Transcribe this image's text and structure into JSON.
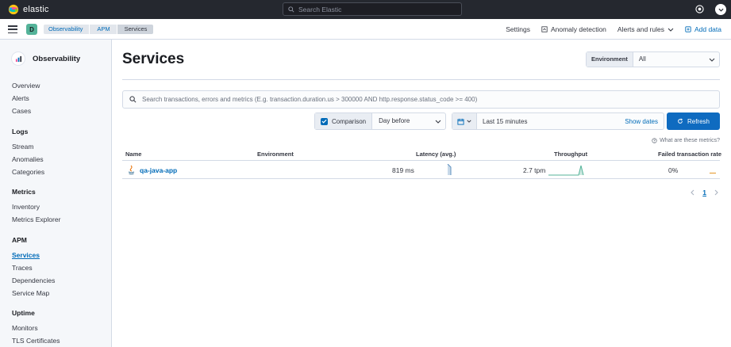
{
  "header": {
    "brand": "elastic",
    "search_placeholder": "Search Elastic"
  },
  "subheader": {
    "space_initial": "D",
    "breadcrumbs": [
      "Observability",
      "APM",
      "Services"
    ],
    "links": {
      "settings": "Settings",
      "anomaly": "Anomaly detection",
      "alerts": "Alerts and rules",
      "add_data": "Add data"
    }
  },
  "sidebar": {
    "title": "Observability",
    "groups": [
      {
        "heading": "",
        "items": [
          "Overview",
          "Alerts",
          "Cases"
        ]
      },
      {
        "heading": "Logs",
        "items": [
          "Stream",
          "Anomalies",
          "Categories"
        ]
      },
      {
        "heading": "Metrics",
        "items": [
          "Inventory",
          "Metrics Explorer"
        ]
      },
      {
        "heading": "APM",
        "items": [
          "Services",
          "Traces",
          "Dependencies",
          "Service Map"
        ]
      },
      {
        "heading": "Uptime",
        "items": [
          "Monitors",
          "TLS Certificates"
        ]
      }
    ],
    "active": "Services"
  },
  "main": {
    "title": "Services",
    "environment": {
      "label": "Environment",
      "value": "All"
    },
    "query_placeholder": "Search transactions, errors and metrics (E.g. transaction.duration.us > 300000 AND http.response.status_code >= 400)",
    "comparison": {
      "label": "Comparison",
      "value": "Day before",
      "checked": true
    },
    "date_range": {
      "value": "Last 15 minutes",
      "show_dates": "Show dates"
    },
    "refresh_label": "Refresh",
    "metrics_help": "What are these metrics?",
    "table": {
      "columns": [
        "Name",
        "Environment",
        "Latency (avg.)",
        "Throughput",
        "Failed transaction rate"
      ],
      "rows": [
        {
          "name": "qa-java-app",
          "environment": "",
          "latency": "819 ms",
          "throughput": "2.7 tpm",
          "failed_rate": "0%"
        }
      ]
    },
    "pagination": {
      "current": "1"
    }
  },
  "colors": {
    "topbar": "#25282f",
    "link": "#006bb8",
    "primary": "#0f6bc0",
    "sparkline_green": "#54b399",
    "sparkline_blue": "#6092c0",
    "sparkline_orange": "#e7a13f"
  }
}
